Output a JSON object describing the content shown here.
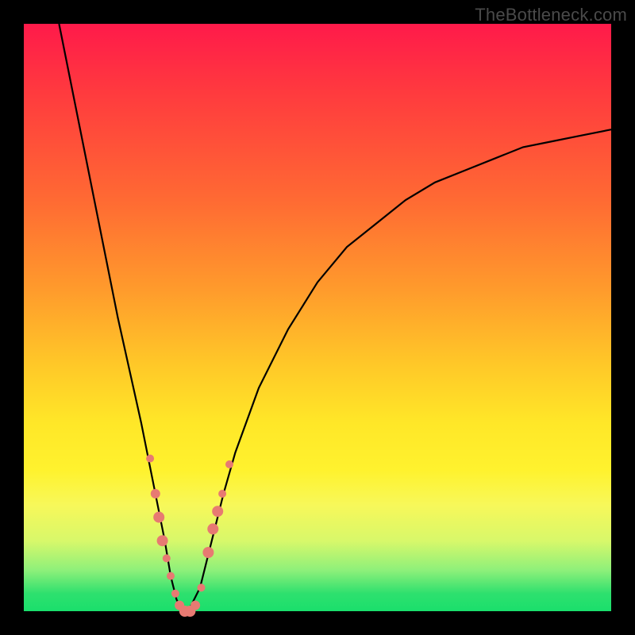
{
  "watermark": "TheBottleneck.com",
  "colors": {
    "frame": "#000000",
    "curve": "#000000",
    "marker_fill": "#e77a72",
    "marker_stroke": "#c9655f"
  },
  "chart_data": {
    "type": "line",
    "title": "",
    "xlabel": "",
    "ylabel": "",
    "xlim": [
      0,
      100
    ],
    "ylim": [
      0,
      100
    ],
    "series": [
      {
        "name": "bottleneck-curve",
        "x": [
          6,
          8,
          10,
          12,
          14,
          16,
          18,
          20,
          22,
          24,
          25,
          26,
          27,
          28,
          30,
          32,
          34,
          36,
          40,
          45,
          50,
          55,
          60,
          65,
          70,
          75,
          80,
          85,
          90,
          95,
          100
        ],
        "y": [
          100,
          90,
          80,
          70,
          60,
          50,
          41,
          32,
          22,
          12,
          6,
          2,
          0,
          0,
          4,
          12,
          20,
          27,
          38,
          48,
          56,
          62,
          66,
          70,
          73,
          75,
          77,
          79,
          80,
          81,
          82
        ]
      }
    ],
    "markers": [
      {
        "x": 21.5,
        "y": 26,
        "r": 5
      },
      {
        "x": 22.4,
        "y": 20,
        "r": 6
      },
      {
        "x": 23.0,
        "y": 16,
        "r": 7
      },
      {
        "x": 23.6,
        "y": 12,
        "r": 7
      },
      {
        "x": 24.3,
        "y": 9,
        "r": 5
      },
      {
        "x": 25.0,
        "y": 6,
        "r": 5
      },
      {
        "x": 25.8,
        "y": 3,
        "r": 5
      },
      {
        "x": 26.5,
        "y": 1,
        "r": 6
      },
      {
        "x": 27.4,
        "y": 0,
        "r": 7
      },
      {
        "x": 28.3,
        "y": 0,
        "r": 7
      },
      {
        "x": 29.2,
        "y": 1,
        "r": 6
      },
      {
        "x": 30.2,
        "y": 4,
        "r": 5
      },
      {
        "x": 31.4,
        "y": 10,
        "r": 7
      },
      {
        "x": 32.2,
        "y": 14,
        "r": 7
      },
      {
        "x": 33.0,
        "y": 17,
        "r": 7
      },
      {
        "x": 33.8,
        "y": 20,
        "r": 5
      },
      {
        "x": 35.0,
        "y": 25,
        "r": 5
      }
    ]
  }
}
